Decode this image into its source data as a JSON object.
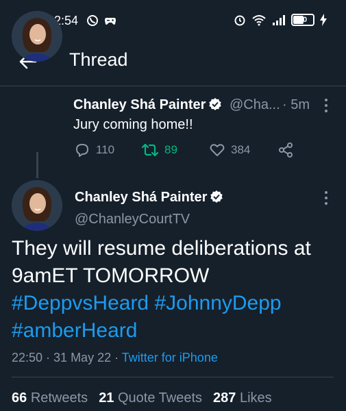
{
  "status_bar": {
    "time": "22:54",
    "battery": "50"
  },
  "header": {
    "title": "Thread"
  },
  "reply_tweet": {
    "name": "Chanley Shá Painter",
    "handle": "@Cha...",
    "time": "· 5m",
    "text": "Jury coming home!!",
    "replies": "110",
    "retweets": "89",
    "likes": "384"
  },
  "main_tweet": {
    "name": "Chanley Shá Painter",
    "handle": "@ChanleyCourtTV",
    "text": "They will resume deliberations at 9amET TOMORROW",
    "hashtags": [
      "#DeppvsHeard",
      "#JohnnyDepp",
      "#amberHeard"
    ],
    "timestamp": "22:50 · 31 May 22 ·",
    "source": "Twitter for iPhone",
    "retweets_count": "66",
    "retweets_label": "Retweets",
    "quotes_count": "21",
    "quotes_label": "Quote Tweets",
    "likes_count": "287",
    "likes_label": "Likes"
  },
  "colors": {
    "background": "#15202b",
    "accent": "#1d9bf0",
    "retweet_green": "#00ba7c",
    "muted": "#8b98a5",
    "divider": "#38444d"
  }
}
